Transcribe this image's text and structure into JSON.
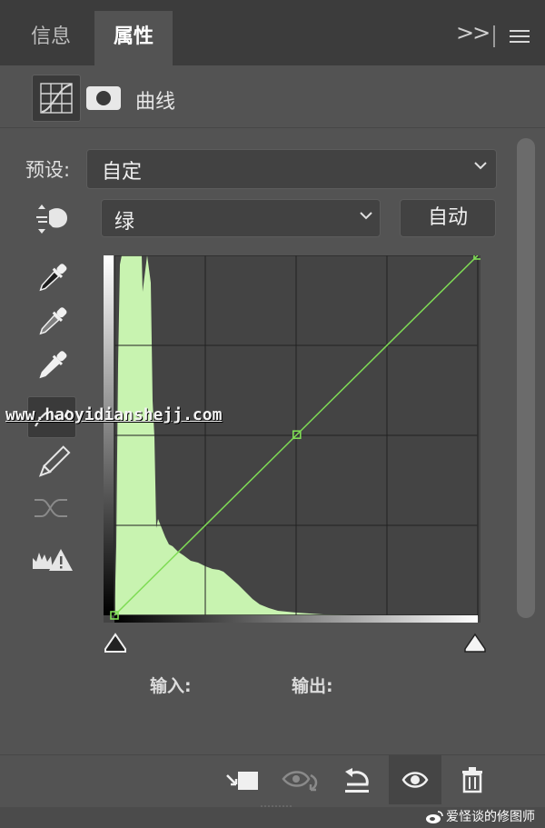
{
  "tabs": [
    {
      "label": "信息",
      "active": false
    },
    {
      "label": "属性",
      "active": true
    }
  ],
  "panel": {
    "title": "曲线",
    "icons": [
      "curves-adjustment-icon",
      "layer-mask-icon"
    ]
  },
  "preset": {
    "label": "预设:",
    "value": "自定"
  },
  "channel": {
    "value": "绿"
  },
  "auto_button": "自动",
  "tools": [
    "on-image-adjust-icon",
    "black-point-eyedropper-icon",
    "gray-point-eyedropper-icon",
    "white-point-eyedropper-icon",
    "point-edit-icon",
    "pencil-icon",
    "smooth-icon",
    "clipping-warning-icon"
  ],
  "curve": {
    "channel_color": "#7fdc55",
    "histogram_color": "#c8f3b0",
    "points": [
      [
        0,
        0
      ],
      [
        128,
        128
      ],
      [
        255,
        255
      ]
    ]
  },
  "io": {
    "input_label": "输入:",
    "output_label": "输出:"
  },
  "bottom_icons": [
    "clip-to-layer-icon",
    "view-previous-state-icon",
    "reset-icon",
    "visibility-eye-icon",
    "delete-icon"
  ],
  "watermark": {
    "url": "www.haoyidianshejj.com",
    "brand": "爱怪谈的修图师"
  },
  "colors": {
    "panel_bg": "#535353",
    "tabbar_bg": "#3c3c3c",
    "graph_bg": "#444444"
  }
}
